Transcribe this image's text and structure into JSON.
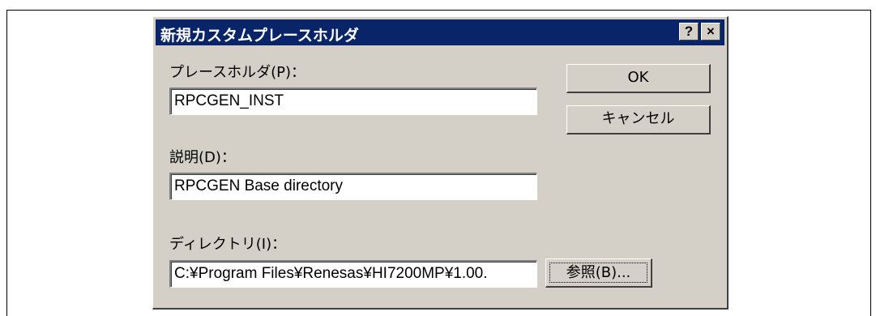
{
  "dialog": {
    "title": "新規カスタムプレースホルダ",
    "help_label": "?",
    "close_label": "×"
  },
  "placeholder": {
    "label": "プレースホルダ(P)：",
    "value": "RPCGEN_INST"
  },
  "description": {
    "label": "説明(D)：",
    "value": "RPCGEN Base directory"
  },
  "directory": {
    "label": "ディレクトリ(I)：",
    "value": "C:¥Program Files¥Renesas¥HI7200MP¥1.00.",
    "browse_label": "参照(B)..."
  },
  "buttons": {
    "ok_label": "OK",
    "cancel_label": "キャンセル"
  },
  "colors": {
    "titlebar": "#0a246a",
    "dialog_bg": "#d4d0c8"
  }
}
